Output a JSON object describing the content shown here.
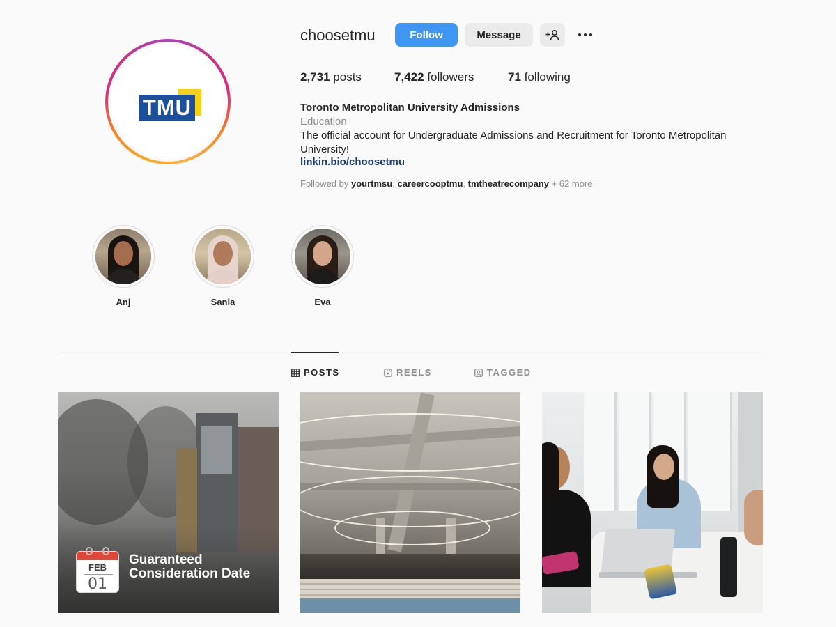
{
  "profile": {
    "username": "choosetmu",
    "logo_text": "TMU",
    "buttons": {
      "follow": "Follow",
      "message": "Message"
    },
    "stats": {
      "posts_count": "2,731",
      "posts_label": "posts",
      "followers_count": "7,422",
      "followers_label": "followers",
      "following_count": "71",
      "following_label": "following"
    },
    "bio": {
      "name": "Toronto Metropolitan University Admissions",
      "category": "Education",
      "text": "The official account for Undergraduate Admissions and Recruitment for Toronto Metropolitan University!",
      "link": "linkin.bio/choosetmu"
    },
    "followed_by": {
      "prefix": "Followed by",
      "users": [
        "yourtmsu",
        "careercooptmu",
        "tmtheatrecompany"
      ],
      "sep": ",",
      "more": "+ 62 more"
    }
  },
  "highlights": [
    {
      "label": "Anj"
    },
    {
      "label": "Sania"
    },
    {
      "label": "Eva"
    }
  ],
  "tabs": {
    "posts": "POSTS",
    "reels": "REELS",
    "tagged": "TAGGED",
    "active": "posts"
  },
  "posts": {
    "first": {
      "calendar_month": "FEB",
      "calendar_day": "01",
      "title": "Guaranteed Consideration Date"
    }
  },
  "colors": {
    "follow_button": "#4097f3",
    "tmu_blue": "#1c4f9c",
    "tmu_yellow": "#f7d117",
    "link": "#1c3d6e"
  },
  "icons": {
    "more": "more-options-icon",
    "suggest": "add-person-icon",
    "posts_tab": "grid-icon",
    "reels_tab": "reels-icon",
    "tagged_tab": "tagged-icon"
  }
}
